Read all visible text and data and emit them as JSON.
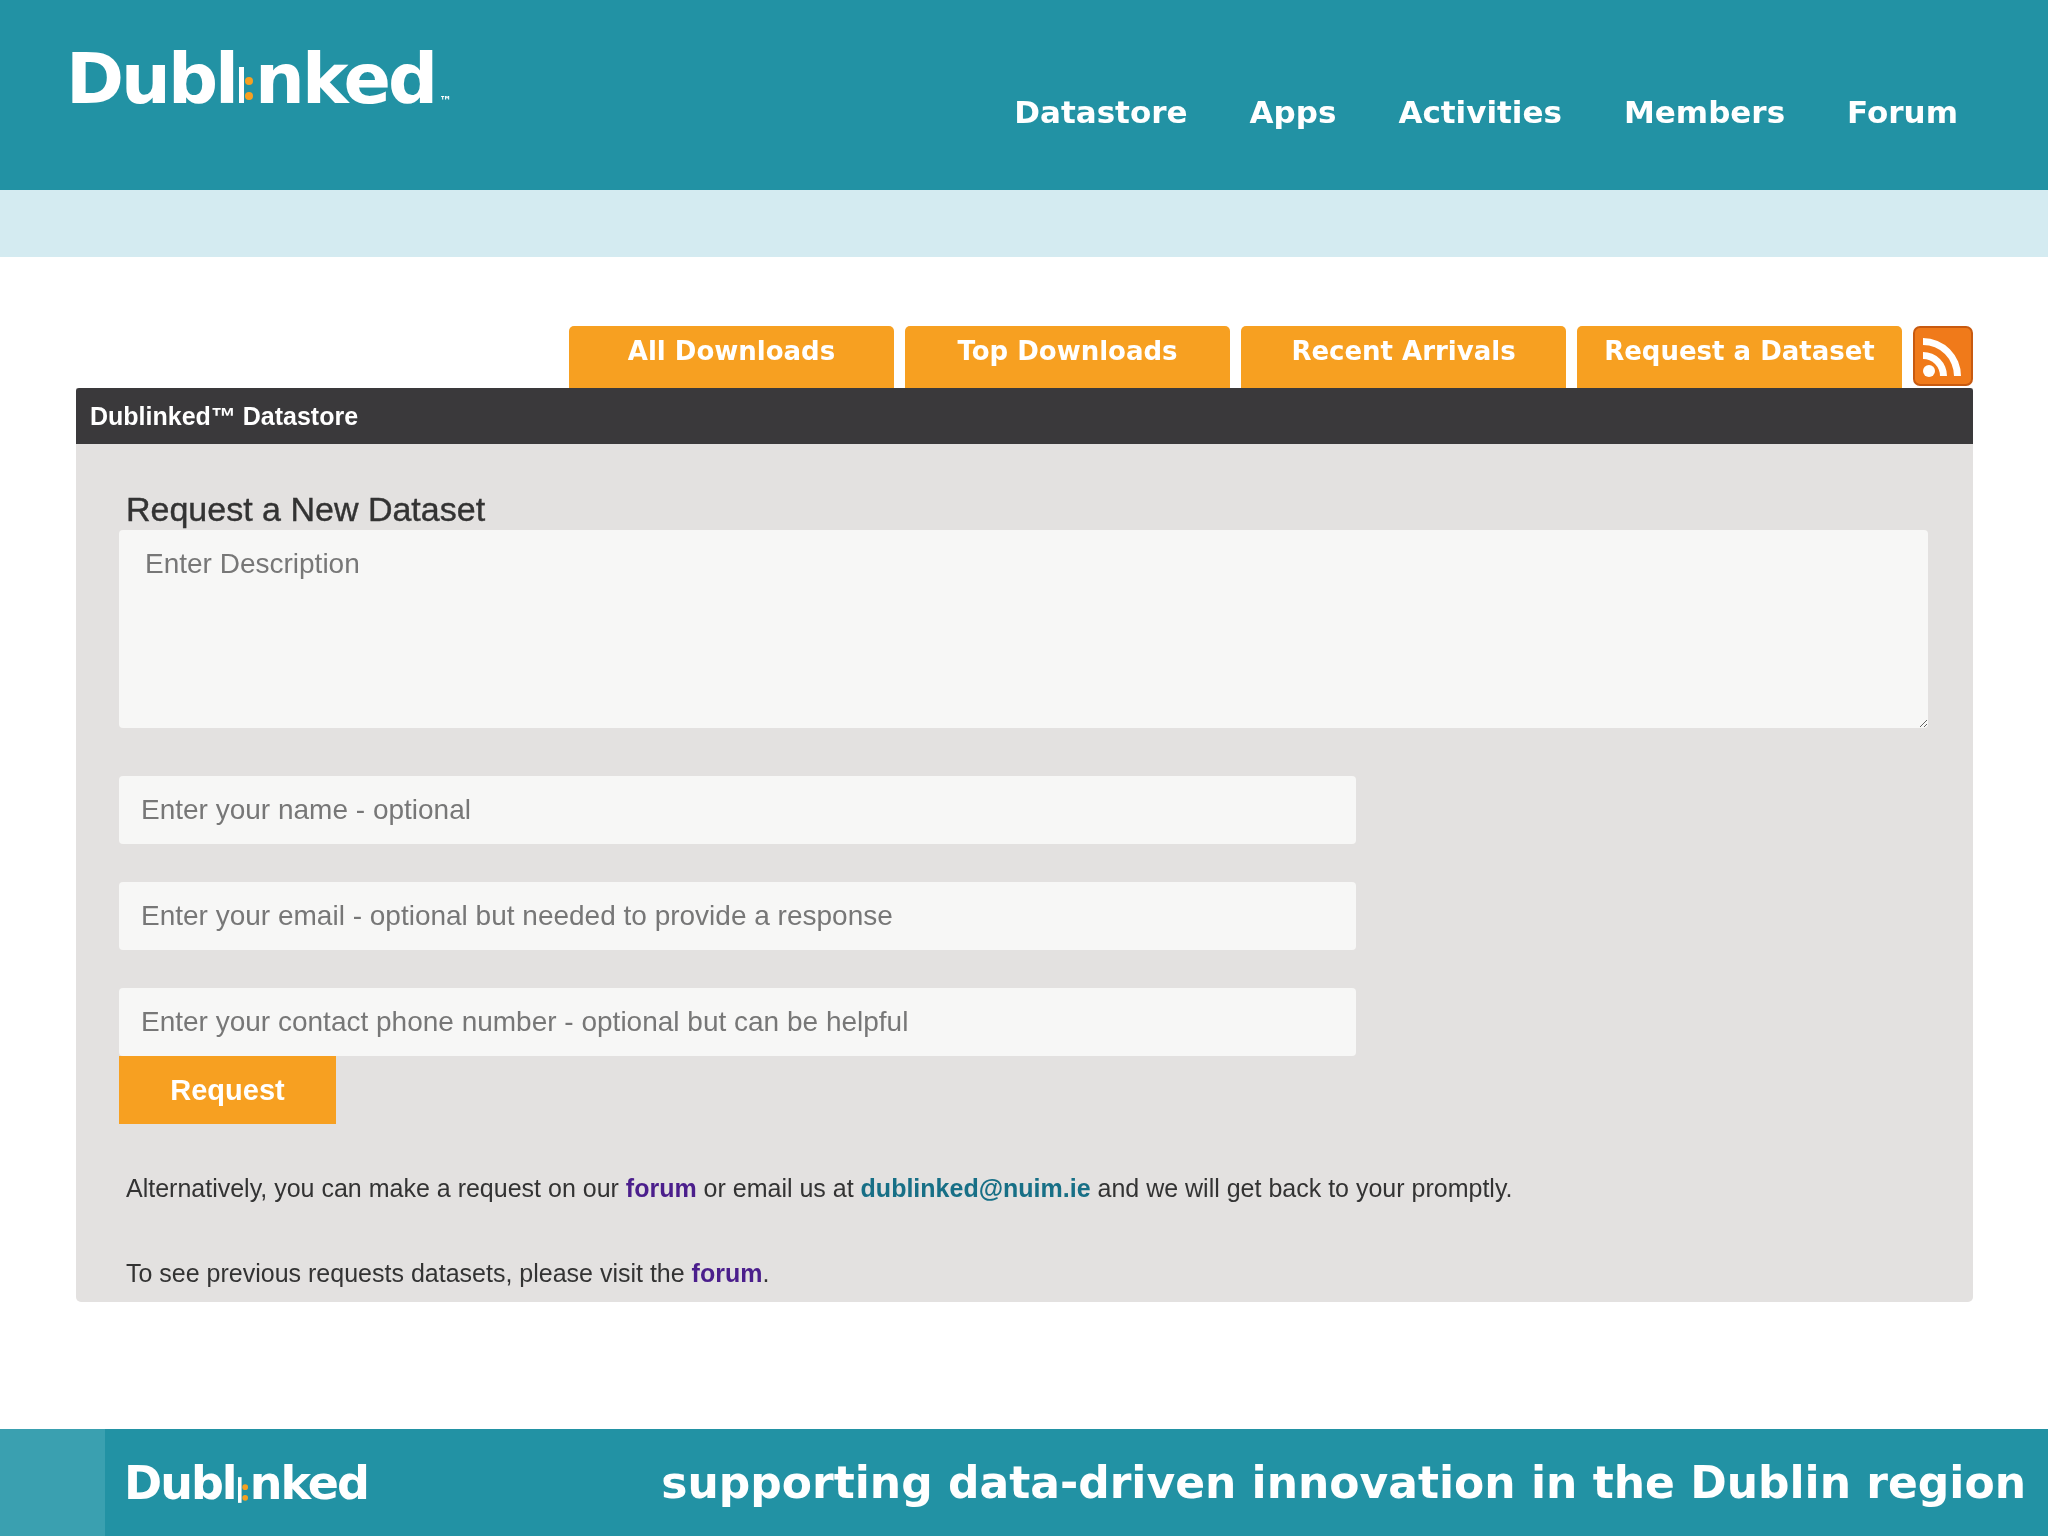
{
  "header": {
    "logo": {
      "before": "Dubl",
      "after": "nked",
      "tm": "™"
    },
    "nav": [
      {
        "label": "Datastore"
      },
      {
        "label": "Apps"
      },
      {
        "label": "Activities"
      },
      {
        "label": "Members"
      },
      {
        "label": "Forum"
      }
    ]
  },
  "tabs": [
    {
      "label": "All Downloads"
    },
    {
      "label": "Top Downloads"
    },
    {
      "label": "Recent Arrivals"
    },
    {
      "label": "Request a Dataset"
    }
  ],
  "panel": {
    "title": "Dublinked™ Datastore",
    "heading": "Request a New Dataset",
    "description": {
      "placeholder": "Enter Description"
    },
    "fields": [
      {
        "placeholder": "Enter your name - optional"
      },
      {
        "placeholder": "Enter your email - optional but needed to provide a response"
      },
      {
        "placeholder": "Enter your contact phone number - optional but can be helpful"
      }
    ],
    "button": "Request",
    "note1": {
      "before": "Alternatively, you can make a request on our ",
      "link": "forum",
      "middle": " or email us at ",
      "email": "dublinked@nuim.ie",
      "after": " and we will get back to your promptly."
    },
    "note2": {
      "before": "To see previous requests datasets, please visit the ",
      "link": "forum",
      "after": "."
    }
  },
  "footer": {
    "logo": {
      "before": "Dubl",
      "after": "nked"
    },
    "tagline": "supporting data-driven innovation in the Dublin region"
  }
}
